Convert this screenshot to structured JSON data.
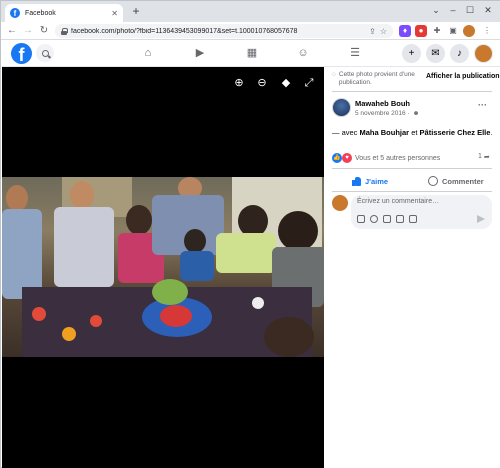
{
  "browser": {
    "tab_title": "Facebook",
    "tab_close": "✕",
    "new_tab": "+",
    "url": "facebook.com/photo/?fbid=1136439453099017&set=t.100010768057678",
    "window_controls": [
      "⌄",
      "–",
      "☐",
      "✕"
    ]
  },
  "header": {
    "logo_letter": "f",
    "search_icon": "search-icon",
    "nav": [
      "home-icon",
      "watch-icon",
      "marketplace-icon",
      "groups-icon",
      "menu-icon"
    ],
    "actions": [
      "create-icon",
      "messenger-icon",
      "notifications-icon",
      "account-avatar"
    ]
  },
  "panel": {
    "public_note": "Cette photo provient d'une publication.",
    "show_post": "Afficher la publication",
    "author": "Mawaheb Bouh",
    "date": "5 novembre 2016 ·",
    "caption_prefix": "— avec ",
    "tag1": "Maha Bouhjar",
    "caption_mid": " et ",
    "tag2": "Pâtisserie Chez Elle",
    "caption_suffix": ".",
    "reactions_text": "Vous et 5 autres personnes",
    "share_count": "1",
    "like_label": "J'aime",
    "comment_label": "Commenter",
    "comment_placeholder": "Écrivez un commentaire…"
  },
  "colors": {
    "brand": "#1877f2",
    "love": "#f33e58"
  }
}
